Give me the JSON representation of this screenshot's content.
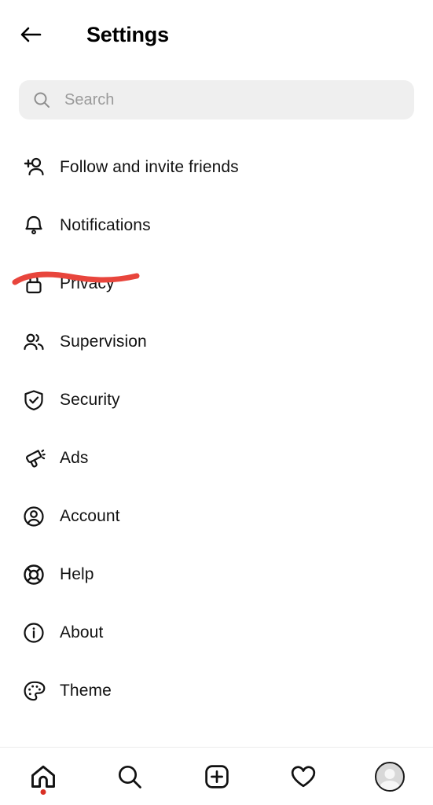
{
  "header": {
    "title": "Settings",
    "back_icon": "arrow-left-icon"
  },
  "search": {
    "placeholder": "Search",
    "value": "",
    "icon": "search-icon"
  },
  "settings_items": [
    {
      "label": "Follow and invite friends",
      "icon": "person-add-icon"
    },
    {
      "label": "Notifications",
      "icon": "bell-icon"
    },
    {
      "label": "Privacy",
      "icon": "lock-icon"
    },
    {
      "label": "Supervision",
      "icon": "people-group-icon"
    },
    {
      "label": "Security",
      "icon": "shield-check-icon"
    },
    {
      "label": "Ads",
      "icon": "megaphone-icon"
    },
    {
      "label": "Account",
      "icon": "user-circle-icon"
    },
    {
      "label": "Help",
      "icon": "lifebuoy-icon"
    },
    {
      "label": "About",
      "icon": "info-circle-icon"
    },
    {
      "label": "Theme",
      "icon": "palette-icon"
    }
  ],
  "annotation": {
    "type": "handdrawn-underline",
    "target": "Privacy",
    "color": "#E8453C"
  },
  "bottom_nav": [
    {
      "name": "home",
      "icon": "home-icon",
      "badge": true,
      "badge_color": "#D93025"
    },
    {
      "name": "search",
      "icon": "search-icon",
      "badge": false
    },
    {
      "name": "create",
      "icon": "plus-square-icon",
      "badge": false
    },
    {
      "name": "activity",
      "icon": "heart-icon",
      "badge": false
    },
    {
      "name": "profile",
      "icon": "avatar-icon",
      "badge": false
    }
  ],
  "colors": {
    "background": "#FFFFFF",
    "text": "#121212",
    "search_bg": "#EFEFEF",
    "placeholder": "#9A9A9A",
    "annotation_red": "#E8453C",
    "divider": "#EDEDED"
  }
}
